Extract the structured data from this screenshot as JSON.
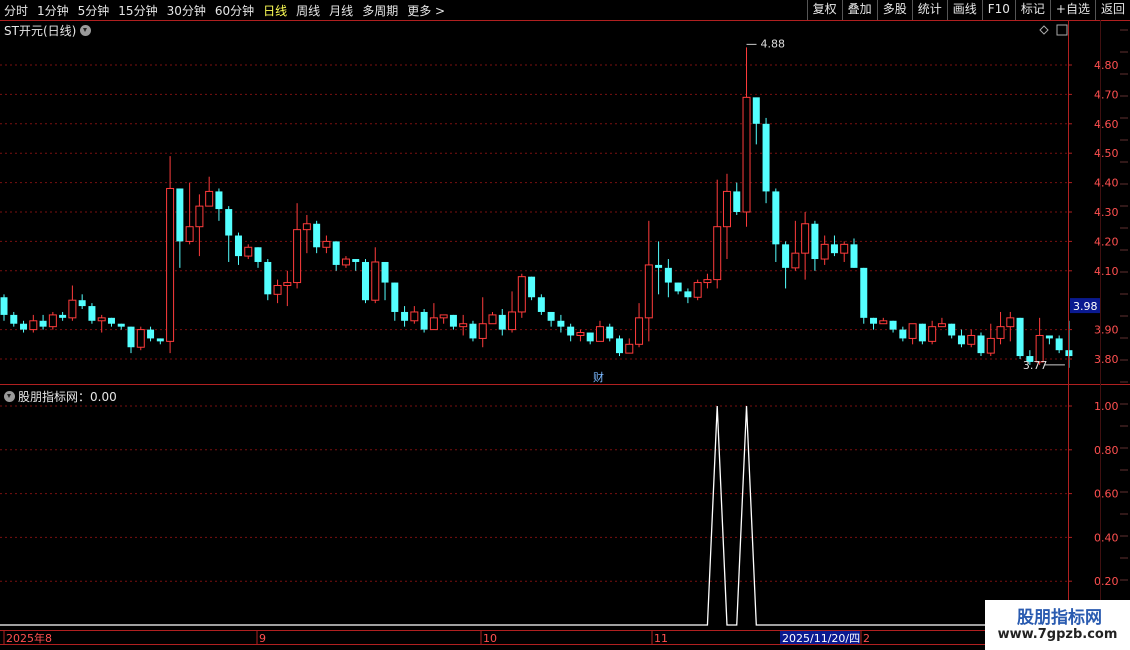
{
  "toolbar": {
    "periods": [
      "分时",
      "1分钟",
      "5分钟",
      "15分钟",
      "30分钟",
      "60分钟",
      "日线",
      "周线",
      "月线",
      "多周期",
      "更多 >"
    ],
    "active_period": "日线",
    "actions": [
      "复权",
      "叠加",
      "多股",
      "统计",
      "画线",
      "F10",
      "标记",
      "+自选",
      "返回"
    ]
  },
  "main_panel": {
    "title": "ST开元(日线)",
    "y_ticks": [
      "4.80",
      "4.70",
      "4.60",
      "4.50",
      "4.40",
      "4.30",
      "4.20",
      "4.10",
      "3.90",
      "3.80"
    ],
    "current_price": "3.98",
    "high_label": "4.88",
    "low_label": "3.77",
    "marker": "财"
  },
  "indicator_panel": {
    "title": "股朋指标网：0.00",
    "y_ticks": [
      "1.00",
      "0.80",
      "0.60",
      "0.40",
      "0.20"
    ]
  },
  "time_axis": {
    "labels": [
      "2025年8",
      "9",
      "10",
      "11",
      "2"
    ],
    "cursor_date": "2025/11/20/四"
  },
  "watermark": {
    "title": "股朋指标网",
    "url": "www.7gpzb.com"
  },
  "colors": {
    "up": "#ff3c3c",
    "down": "#54ffff",
    "grid": "#7a1010",
    "axis": "#b02020"
  },
  "chart_data": {
    "type": "candlestick",
    "price_range": [
      3.77,
      4.88
    ],
    "candles": [
      [
        4.01,
        3.95,
        4.02,
        3.93
      ],
      [
        3.95,
        3.92,
        3.96,
        3.91
      ],
      [
        3.92,
        3.9,
        3.93,
        3.89
      ],
      [
        3.9,
        3.93,
        3.95,
        3.89
      ],
      [
        3.93,
        3.91,
        3.95,
        3.9
      ],
      [
        3.91,
        3.95,
        3.96,
        3.9
      ],
      [
        3.95,
        3.94,
        3.96,
        3.93
      ],
      [
        3.94,
        4.0,
        4.05,
        3.93
      ],
      [
        4.0,
        3.98,
        4.02,
        3.97
      ],
      [
        3.98,
        3.93,
        3.99,
        3.92
      ],
      [
        3.93,
        3.94,
        3.95,
        3.89
      ],
      [
        3.94,
        3.92,
        3.94,
        3.91
      ],
      [
        3.92,
        3.91,
        3.92,
        3.9
      ],
      [
        3.91,
        3.84,
        3.91,
        3.82
      ],
      [
        3.84,
        3.9,
        3.91,
        3.83
      ],
      [
        3.9,
        3.87,
        3.91,
        3.86
      ],
      [
        3.87,
        3.86,
        3.87,
        3.85
      ],
      [
        3.86,
        4.38,
        4.49,
        3.82
      ],
      [
        4.38,
        4.2,
        4.38,
        4.11
      ],
      [
        4.2,
        4.25,
        4.4,
        4.19
      ],
      [
        4.25,
        4.32,
        4.36,
        4.15
      ],
      [
        4.32,
        4.37,
        4.42,
        4.33
      ],
      [
        4.37,
        4.31,
        4.38,
        4.27
      ],
      [
        4.31,
        4.22,
        4.32,
        4.13
      ],
      [
        4.22,
        4.15,
        4.23,
        4.12
      ],
      [
        4.15,
        4.18,
        4.19,
        4.14
      ],
      [
        4.18,
        4.13,
        4.18,
        4.11
      ],
      [
        4.13,
        4.02,
        4.14,
        4.0
      ],
      [
        4.02,
        4.05,
        4.07,
        3.99
      ],
      [
        4.05,
        4.06,
        4.1,
        3.98
      ],
      [
        4.06,
        4.24,
        4.33,
        4.04
      ],
      [
        4.24,
        4.26,
        4.29,
        4.16
      ],
      [
        4.26,
        4.18,
        4.27,
        4.16
      ],
      [
        4.18,
        4.2,
        4.22,
        4.16
      ],
      [
        4.2,
        4.12,
        4.2,
        4.1
      ],
      [
        4.12,
        4.14,
        4.15,
        4.11
      ],
      [
        4.14,
        4.13,
        4.14,
        4.1
      ],
      [
        4.13,
        4.0,
        4.14,
        3.99
      ],
      [
        4.0,
        4.13,
        4.18,
        3.99
      ],
      [
        4.13,
        4.06,
        4.13,
        4.0
      ],
      [
        4.06,
        3.96,
        4.06,
        3.93
      ],
      [
        3.96,
        3.93,
        3.98,
        3.91
      ],
      [
        3.93,
        3.96,
        3.98,
        3.92
      ],
      [
        3.96,
        3.9,
        3.97,
        3.89
      ],
      [
        3.9,
        3.94,
        3.99,
        3.9
      ],
      [
        3.94,
        3.95,
        3.95,
        3.92
      ],
      [
        3.95,
        3.91,
        3.95,
        3.9
      ],
      [
        3.91,
        3.92,
        3.95,
        3.88
      ],
      [
        3.92,
        3.87,
        3.93,
        3.86
      ],
      [
        3.87,
        3.92,
        4.01,
        3.84
      ],
      [
        3.92,
        3.95,
        3.96,
        3.93
      ],
      [
        3.95,
        3.9,
        3.97,
        3.88
      ],
      [
        3.9,
        3.96,
        4.03,
        3.89
      ],
      [
        3.96,
        4.08,
        4.09,
        3.94
      ],
      [
        4.08,
        4.01,
        4.08,
        4.0
      ],
      [
        4.01,
        3.96,
        4.02,
        3.95
      ],
      [
        3.96,
        3.93,
        3.96,
        3.91
      ],
      [
        3.93,
        3.91,
        3.95,
        3.89
      ],
      [
        3.91,
        3.88,
        3.92,
        3.86
      ],
      [
        3.88,
        3.89,
        3.9,
        3.86
      ],
      [
        3.89,
        3.86,
        3.89,
        3.85
      ],
      [
        3.86,
        3.91,
        3.93,
        3.86
      ],
      [
        3.91,
        3.87,
        3.92,
        3.86
      ],
      [
        3.87,
        3.82,
        3.88,
        3.81
      ],
      [
        3.82,
        3.85,
        3.87,
        3.82
      ],
      [
        3.85,
        3.94,
        3.99,
        3.84
      ],
      [
        3.94,
        4.12,
        4.27,
        3.86
      ],
      [
        4.12,
        4.11,
        4.2,
        4.02
      ],
      [
        4.11,
        4.06,
        4.14,
        4.01
      ],
      [
        4.06,
        4.03,
        4.06,
        4.02
      ],
      [
        4.03,
        4.01,
        4.04,
        3.99
      ],
      [
        4.01,
        4.06,
        4.07,
        4.0
      ],
      [
        4.06,
        4.07,
        4.09,
        4.04
      ],
      [
        4.07,
        4.25,
        4.41,
        4.04
      ],
      [
        4.25,
        4.37,
        4.43,
        4.14
      ],
      [
        4.37,
        4.3,
        4.4,
        4.29
      ],
      [
        4.3,
        4.69,
        4.86,
        4.25
      ],
      [
        4.69,
        4.6,
        4.68,
        4.53
      ],
      [
        4.6,
        4.37,
        4.62,
        4.33
      ],
      [
        4.37,
        4.19,
        4.38,
        4.13
      ],
      [
        4.19,
        4.11,
        4.2,
        4.04
      ],
      [
        4.11,
        4.16,
        4.27,
        4.1
      ],
      [
        4.16,
        4.26,
        4.3,
        4.07
      ],
      [
        4.26,
        4.14,
        4.27,
        4.1
      ],
      [
        4.14,
        4.19,
        4.22,
        4.12
      ],
      [
        4.19,
        4.16,
        4.22,
        4.15
      ],
      [
        4.16,
        4.19,
        4.2,
        4.13
      ],
      [
        4.19,
        4.11,
        4.21,
        4.11
      ],
      [
        4.11,
        3.94,
        4.11,
        3.92
      ],
      [
        3.94,
        3.92,
        3.94,
        3.9
      ],
      [
        3.92,
        3.93,
        3.94,
        3.92
      ],
      [
        3.93,
        3.9,
        3.93,
        3.89
      ],
      [
        3.9,
        3.87,
        3.91,
        3.86
      ],
      [
        3.87,
        3.92,
        3.92,
        3.85
      ],
      [
        3.92,
        3.86,
        3.92,
        3.85
      ],
      [
        3.86,
        3.91,
        3.93,
        3.85
      ],
      [
        3.91,
        3.92,
        3.94,
        3.91
      ],
      [
        3.92,
        3.88,
        3.92,
        3.87
      ],
      [
        3.88,
        3.85,
        3.9,
        3.84
      ],
      [
        3.85,
        3.88,
        3.9,
        3.84
      ],
      [
        3.88,
        3.82,
        3.89,
        3.81
      ],
      [
        3.82,
        3.87,
        3.92,
        3.81
      ],
      [
        3.87,
        3.91,
        3.96,
        3.85
      ],
      [
        3.91,
        3.94,
        3.96,
        3.86
      ],
      [
        3.94,
        3.81,
        3.94,
        3.8
      ],
      [
        3.81,
        3.79,
        3.83,
        3.78
      ],
      [
        3.79,
        3.88,
        3.94,
        3.78
      ],
      [
        3.88,
        3.87,
        3.88,
        3.85
      ],
      [
        3.87,
        3.83,
        3.88,
        3.82
      ],
      [
        3.83,
        3.81,
        3.93,
        3.77
      ]
    ],
    "indicator": {
      "range": [
        0,
        1.0
      ],
      "values": [
        0,
        0,
        0,
        0,
        0,
        0,
        0,
        0,
        0,
        0,
        0,
        0,
        0,
        0,
        0,
        0,
        0,
        0,
        0,
        0,
        0,
        0,
        0,
        0,
        0,
        0,
        0,
        0,
        0,
        0,
        0,
        0,
        0,
        0,
        0,
        0,
        0,
        0,
        0,
        0,
        0,
        0,
        0,
        0,
        0,
        0,
        0,
        0,
        0,
        0,
        0,
        0,
        0,
        0,
        0,
        0,
        0,
        0,
        0,
        0,
        0,
        0,
        0,
        0,
        0,
        0,
        0,
        0,
        0,
        0,
        0,
        0,
        0,
        1,
        0,
        0,
        1,
        0,
        0,
        0,
        0,
        0,
        0,
        0,
        0,
        0,
        0,
        0,
        0,
        0,
        0,
        0,
        0,
        0,
        0,
        0,
        0,
        0,
        0,
        0,
        0,
        0,
        0,
        0,
        0,
        0,
        0,
        0,
        0,
        0
      ]
    }
  }
}
